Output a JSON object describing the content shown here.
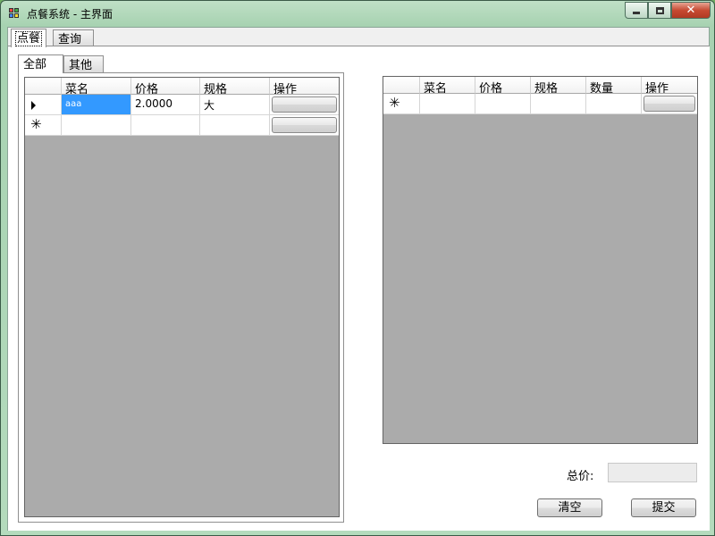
{
  "window": {
    "title": "点餐系统 - 主界面"
  },
  "main_tabs": [
    {
      "label": "点餐"
    },
    {
      "label": "查询"
    }
  ],
  "sub_tabs": [
    {
      "label": "全部"
    },
    {
      "label": "其他"
    }
  ],
  "menu_grid": {
    "columns": [
      "菜名",
      "价格",
      "规格",
      "操作"
    ],
    "rows": [
      {
        "name": "aaa",
        "price": "2.0000",
        "spec": "大"
      }
    ]
  },
  "order_grid": {
    "columns": [
      "菜名",
      "价格",
      "规格",
      "数量",
      "操作"
    ]
  },
  "total": {
    "label": "总价:",
    "value": ""
  },
  "buttons": {
    "clear": "清空",
    "submit": "提交"
  },
  "colors": {
    "selection": "#3399ff",
    "grid_background": "#ababab"
  }
}
